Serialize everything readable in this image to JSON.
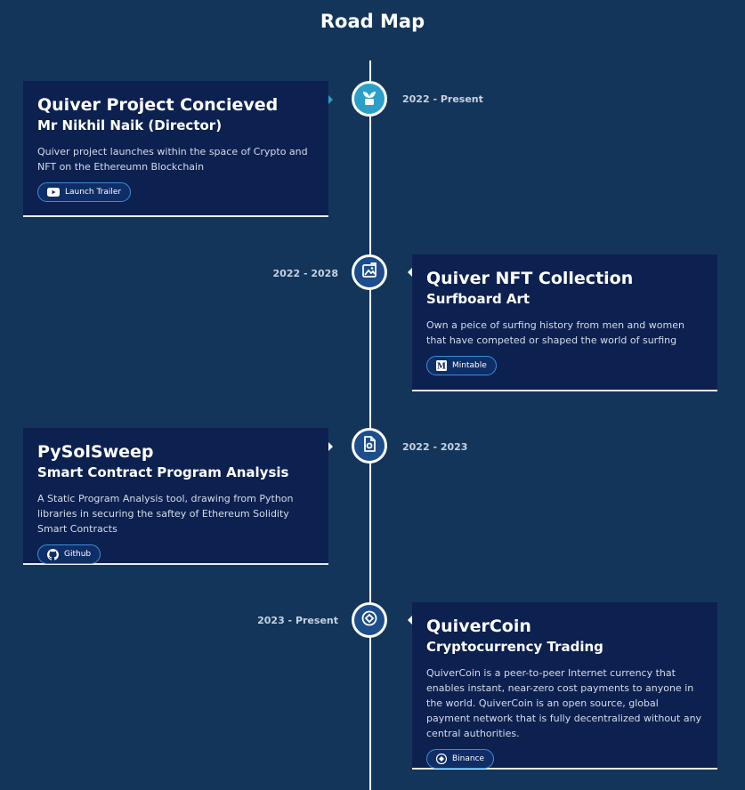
{
  "page": {
    "title": "Road Map"
  },
  "colors": {
    "background": "#14355a",
    "card": "#0d2150",
    "node": "#1d4d8a",
    "node_active": "#2aa0c8",
    "pill_border": "#3a8fd6"
  },
  "items": [
    {
      "title": "Quiver Project Concieved",
      "subtitle": "Mr Nikhil Naik (Director)",
      "description": "Quiver project launches within the space of Crypto and NFT on the Ethereumn Blockchain",
      "date": "2022 - Present",
      "icon": "plant-icon",
      "button": {
        "label": "Launch Trailer",
        "icon": "youtube-icon"
      }
    },
    {
      "title": "Quiver NFT Collection",
      "subtitle": "Surfboard Art",
      "description": "Own a peice of surfing history from men and women that have competed or shaped the world of surfing",
      "date": "2022 - 2028",
      "icon": "art-frame-icon",
      "button": {
        "label": "Mintable",
        "icon": "mintable-icon"
      }
    },
    {
      "title": "PySolSweep",
      "subtitle": "Smart Contract Program Analysis",
      "description": "A Static Program Analysis tool, drawing from Python libraries in securing the saftey of Ethereum Solidity Smart Contracts",
      "date": "2022 - 2023",
      "icon": "document-icon",
      "button": {
        "label": "Github",
        "icon": "github-icon"
      }
    },
    {
      "title": "QuiverCoin",
      "subtitle": "Cryptocurrency Trading",
      "description": "QuiverCoin is a peer-to-peer Internet currency that enables instant, near-zero cost payments to anyone in the world. QuiverCoin is an open source, global payment network that is fully decentralized without any central authorities.",
      "date": "2023 - Present",
      "icon": "coin-icon",
      "button": {
        "label": "Binance",
        "icon": "binance-icon"
      }
    }
  ]
}
